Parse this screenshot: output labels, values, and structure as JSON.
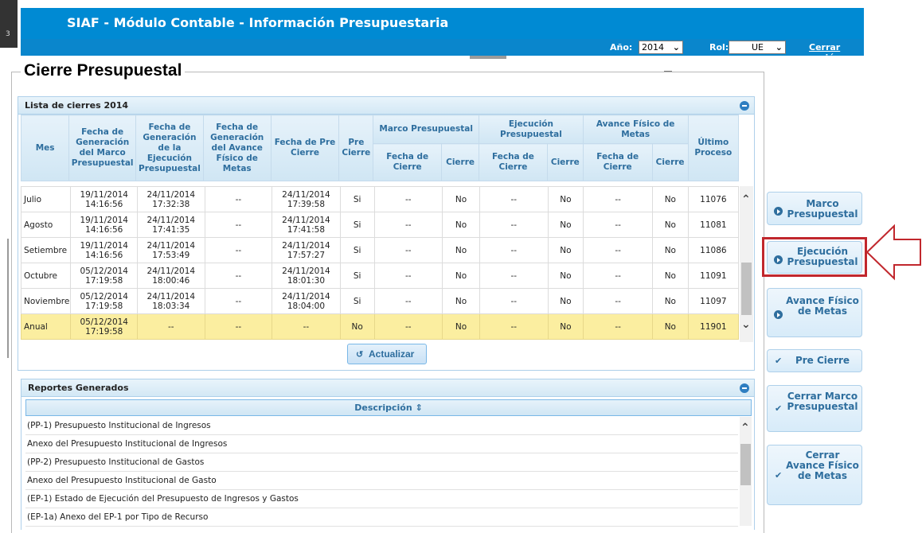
{
  "header": {
    "title": "SIAF - Módulo Contable - Información Presupuestaria",
    "year_label": "Año:",
    "year_value": "2014",
    "role_label": "Rol:",
    "role_value": "UE",
    "logout": "Cerrar sesión"
  },
  "page": {
    "title": "Cierre Presupuestal"
  },
  "closures": {
    "panel_title": "Lista de cierres 2014",
    "columns": {
      "mes": "Mes",
      "fecha_marco": "Fecha de Generación del Marco Presupuestal",
      "fecha_ejecucion": "Fecha de Generación de la Ejecución Presupuestal",
      "fecha_avance": "Fecha de Generación del Avance Físico de Metas",
      "fecha_pre_cierre": "Fecha de Pre Cierre",
      "pre_cierre": "Pre Cierre",
      "marco_group": "Marco Presupuestal",
      "ejecucion_group": "Ejecución Presupuestal",
      "avance_group": "Avance Físico de Metas",
      "fecha_de_cierre": "Fecha de Cierre",
      "cierre": "Cierre",
      "ultimo_proceso": "Último Proceso"
    },
    "rows": [
      {
        "mes": "Julio",
        "marco": "19/11/2014 14:16:56",
        "ejec": "24/11/2014 17:32:38",
        "avance": "--",
        "precierre_fecha": "24/11/2014 17:39:58",
        "pre": "Si",
        "m_fecha": "--",
        "m_cierre": "No",
        "e_fecha": "--",
        "e_cierre": "No",
        "a_fecha": "--",
        "a_cierre": "No",
        "proceso": "11076"
      },
      {
        "mes": "Agosto",
        "marco": "19/11/2014 14:16:56",
        "ejec": "24/11/2014 17:41:35",
        "avance": "--",
        "precierre_fecha": "24/11/2014 17:41:58",
        "pre": "Si",
        "m_fecha": "--",
        "m_cierre": "No",
        "e_fecha": "--",
        "e_cierre": "No",
        "a_fecha": "--",
        "a_cierre": "No",
        "proceso": "11081"
      },
      {
        "mes": "Setiembre",
        "marco": "19/11/2014 14:16:56",
        "ejec": "24/11/2014 17:53:49",
        "avance": "--",
        "precierre_fecha": "24/11/2014 17:57:27",
        "pre": "Si",
        "m_fecha": "--",
        "m_cierre": "No",
        "e_fecha": "--",
        "e_cierre": "No",
        "a_fecha": "--",
        "a_cierre": "No",
        "proceso": "11086"
      },
      {
        "mes": "Octubre",
        "marco": "05/12/2014 17:19:58",
        "ejec": "24/11/2014 18:00:46",
        "avance": "--",
        "precierre_fecha": "24/11/2014 18:01:30",
        "pre": "Si",
        "m_fecha": "--",
        "m_cierre": "No",
        "e_fecha": "--",
        "e_cierre": "No",
        "a_fecha": "--",
        "a_cierre": "No",
        "proceso": "11091"
      },
      {
        "mes": "Noviembre",
        "marco": "05/12/2014 17:19:58",
        "ejec": "24/11/2014 18:03:34",
        "avance": "--",
        "precierre_fecha": "24/11/2014 18:04:00",
        "pre": "Si",
        "m_fecha": "--",
        "m_cierre": "No",
        "e_fecha": "--",
        "e_cierre": "No",
        "a_fecha": "--",
        "a_cierre": "No",
        "proceso": "11097"
      },
      {
        "mes": "Anual",
        "marco": "05/12/2014 17:19:58",
        "ejec": "--",
        "avance": "--",
        "precierre_fecha": "--",
        "pre": "No",
        "m_fecha": "--",
        "m_cierre": "No",
        "e_fecha": "--",
        "e_cierre": "No",
        "a_fecha": "--",
        "a_cierre": "No",
        "proceso": "11901"
      }
    ],
    "refresh_label": "Actualizar"
  },
  "reports": {
    "panel_title": "Reportes Generados",
    "column_header": "Descripción",
    "items": [
      "(PP-1) Presupuesto Institucional de Ingresos",
      "Anexo del Presupuesto Institucional de Ingresos",
      "(PP-2) Presupuesto Institucional de Gastos",
      "Anexo del Presupuesto Institucional de Gasto",
      "(EP-1) Estado de Ejecución del Presupuesto de Ingresos y Gastos",
      "(EP-1a) Anexo del EP-1 por Tipo de Recurso"
    ]
  },
  "side_buttons": {
    "marco": "Marco Presupuestal",
    "ejecucion": "Ejecución Presupuestal",
    "avance": "Avance Físico de Metas",
    "pre_cierre": "Pre Cierre",
    "cerrar_marco": "Cerrar Marco Presupuestal",
    "cerrar_avance": "Cerrar Avance Físico de Metas"
  },
  "colors": {
    "header_blue": "#008ad3",
    "accent_text": "#2e6e9e",
    "annual_row": "#fbeea0",
    "highlight_red": "#c1272d"
  }
}
